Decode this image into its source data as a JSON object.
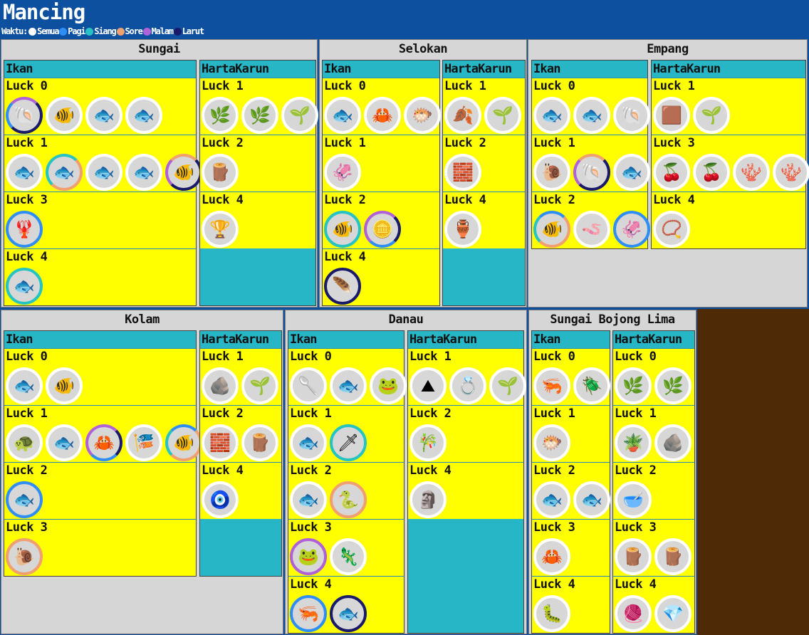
{
  "app": {
    "title": "Mancing",
    "legend_label": "Waktu:",
    "times": [
      {
        "name": "Semua",
        "color": "#ffffff"
      },
      {
        "name": "Pagi",
        "color": "#2f8ef5"
      },
      {
        "name": "Siang",
        "color": "#27c3c3"
      },
      {
        "name": "Sore",
        "color": "#f0a070"
      },
      {
        "name": "Malam",
        "color": "#b060d8"
      },
      {
        "name": "Larut",
        "color": "#1a1a6a"
      }
    ]
  },
  "columns": {
    "fish": "Ikan",
    "treasure": "HartaKarun"
  },
  "locations": {
    "sungai": {
      "name": "Sungai",
      "fish": [
        {
          "luck": "Luck 0",
          "items": [
            {
              "icon": "snail-shell-icon",
              "time": "mix1"
            },
            {
              "icon": "yellow-fish-icon",
              "time": "semua"
            },
            {
              "icon": "carp-icon",
              "time": "semua"
            },
            {
              "icon": "blue-fish-icon",
              "time": "semua"
            }
          ]
        },
        {
          "luck": "Luck 1",
          "items": [
            {
              "icon": "catfish-icon",
              "time": "semua"
            },
            {
              "icon": "silver-fish-icon",
              "time": "mix2"
            },
            {
              "icon": "eel-fish-icon",
              "time": "semua"
            },
            {
              "icon": "mudfish-icon",
              "time": "semua"
            },
            {
              "icon": "tropical-fish-icon",
              "time": "mix3"
            }
          ]
        },
        {
          "luck": "Luck 3",
          "items": [
            {
              "icon": "red-lobster-icon",
              "time": "pagi"
            }
          ]
        },
        {
          "luck": "Luck 4",
          "items": [
            {
              "icon": "pale-fish-icon",
              "time": "siang"
            }
          ]
        }
      ],
      "treasure": [
        {
          "luck": "Luck 1",
          "items": [
            {
              "icon": "herb-sprig-icon",
              "time": "semua"
            },
            {
              "icon": "twig-icon",
              "time": "semua"
            },
            {
              "icon": "moss-clump-icon",
              "time": "semua"
            }
          ]
        },
        {
          "luck": "Luck 2",
          "items": [
            {
              "icon": "log-icon",
              "time": "semua"
            }
          ]
        },
        {
          "luck": "Luck 4",
          "items": [
            {
              "icon": "goblet-icon",
              "time": "semua"
            }
          ]
        }
      ]
    },
    "selokan": {
      "name": "Selokan",
      "fish": [
        {
          "luck": "Luck 0",
          "items": [
            {
              "icon": "pink-fish-icon",
              "time": "semua"
            },
            {
              "icon": "crab-icon",
              "time": "semua"
            },
            {
              "icon": "white-box-fish-icon",
              "time": "semua"
            }
          ]
        },
        {
          "luck": "Luck 1",
          "items": [
            {
              "icon": "grey-squid-icon",
              "time": "semua"
            }
          ]
        },
        {
          "luck": "Luck 2",
          "items": [
            {
              "icon": "red-white-fish-icon",
              "time": "siang"
            },
            {
              "icon": "golden-disc-icon",
              "time": "mix5"
            }
          ]
        },
        {
          "luck": "Luck 4",
          "items": [
            {
              "icon": "feather-icon",
              "time": "larut"
            }
          ]
        }
      ],
      "treasure": [
        {
          "luck": "Luck 1",
          "items": [
            {
              "icon": "dried-leaf-icon",
              "time": "semua"
            },
            {
              "icon": "moss-clump-icon",
              "time": "semua"
            }
          ]
        },
        {
          "luck": "Luck 2",
          "items": [
            {
              "icon": "stone-brick-icon",
              "time": "semua"
            }
          ]
        },
        {
          "luck": "Luck 4",
          "items": [
            {
              "icon": "vase-icon",
              "time": "semua"
            }
          ]
        }
      ]
    },
    "empang": {
      "name": "Empang",
      "fish": [
        {
          "luck": "Luck 0",
          "items": [
            {
              "icon": "catfish-icon",
              "time": "semua"
            },
            {
              "icon": "silver-fish-icon",
              "time": "semua"
            },
            {
              "icon": "clam-icon",
              "time": "semua"
            }
          ]
        },
        {
          "luck": "Luck 1",
          "items": [
            {
              "icon": "snail-icon",
              "time": "semua"
            },
            {
              "icon": "mussel-icon",
              "time": "mix3"
            },
            {
              "icon": "spotted-fish-icon",
              "time": "semua"
            }
          ]
        },
        {
          "luck": "Luck 2",
          "items": [
            {
              "icon": "goldfish-icon",
              "time": "mix4"
            },
            {
              "icon": "worm-icon",
              "time": "semua"
            },
            {
              "icon": "dark-squid-icon",
              "time": "pagi"
            }
          ]
        }
      ],
      "treasure": [
        {
          "luck": "Luck 1",
          "items": [
            {
              "icon": "brown-block-icon",
              "time": "semua"
            },
            {
              "icon": "moss-clump-icon",
              "time": "semua"
            }
          ]
        },
        {
          "luck": "Luck 3",
          "items": [
            {
              "icon": "red-berry-icon",
              "time": "semua"
            },
            {
              "icon": "red-berry-icon",
              "time": "semua"
            },
            {
              "icon": "red-coral-icon",
              "time": "semua"
            },
            {
              "icon": "red-coral-icon",
              "time": "semua"
            }
          ]
        },
        {
          "luck": "Luck 4",
          "items": [
            {
              "icon": "pearl-necklace-icon",
              "time": "semua"
            }
          ]
        }
      ]
    },
    "kolam": {
      "name": "Kolam",
      "fish": [
        {
          "luck": "Luck 0",
          "items": [
            {
              "icon": "grey-fish-icon",
              "time": "semua"
            },
            {
              "icon": "betta-fish-icon",
              "time": "semua"
            }
          ]
        },
        {
          "luck": "Luck 1",
          "items": [
            {
              "icon": "turtle-icon",
              "time": "semua"
            },
            {
              "icon": "long-fish-icon",
              "time": "semua"
            },
            {
              "icon": "orange-crab-icon",
              "time": "mix5"
            },
            {
              "icon": "koi-icon",
              "time": "semua"
            },
            {
              "icon": "rainbow-fish-icon",
              "time": "mix4"
            }
          ]
        },
        {
          "luck": "Luck 2",
          "items": [
            {
              "icon": "red-snapper-icon",
              "time": "pagi"
            }
          ]
        },
        {
          "luck": "Luck 3",
          "items": [
            {
              "icon": "sea-slug-icon",
              "time": "sore"
            }
          ]
        }
      ],
      "treasure": [
        {
          "luck": "Luck 1",
          "items": [
            {
              "icon": "rock-icon",
              "time": "semua"
            },
            {
              "icon": "moss-clump-icon",
              "time": "semua"
            }
          ]
        },
        {
          "luck": "Luck 2",
          "items": [
            {
              "icon": "stone-brick-icon",
              "time": "semua"
            },
            {
              "icon": "log-icon",
              "time": "semua"
            }
          ]
        },
        {
          "luck": "Luck 4",
          "items": [
            {
              "icon": "amulet-icon",
              "time": "semua"
            }
          ]
        }
      ]
    },
    "danau": {
      "name": "Danau",
      "fish": [
        {
          "luck": "Luck 0",
          "items": [
            {
              "icon": "tadpole-icon",
              "time": "semua"
            },
            {
              "icon": "minnow-icon",
              "time": "semua"
            },
            {
              "icon": "frog-icon",
              "time": "semua"
            }
          ]
        },
        {
          "luck": "Luck 1",
          "items": [
            {
              "icon": "bass-icon",
              "time": "semua"
            },
            {
              "icon": "needle-fish-icon",
              "time": "siang"
            }
          ]
        },
        {
          "luck": "Luck 2",
          "items": [
            {
              "icon": "flounder-icon",
              "time": "semua"
            },
            {
              "icon": "lake-eel-icon",
              "time": "sore"
            }
          ]
        },
        {
          "luck": "Luck 3",
          "items": [
            {
              "icon": "toad-icon",
              "time": "malam"
            },
            {
              "icon": "lizard-icon",
              "time": "semua"
            }
          ]
        },
        {
          "luck": "Luck 4",
          "items": [
            {
              "icon": "ghost-shrimp-icon",
              "time": "pagi"
            },
            {
              "icon": "white-fish-icon",
              "time": "larut"
            }
          ]
        }
      ],
      "treasure": [
        {
          "luck": "Luck 1",
          "items": [
            {
              "icon": "sand-pile-icon",
              "time": "semua"
            },
            {
              "icon": "ring-icon",
              "time": "semua"
            },
            {
              "icon": "moss-clump-icon",
              "time": "semua"
            }
          ]
        },
        {
          "luck": "Luck 2",
          "items": [
            {
              "icon": "bamboo-icon",
              "time": "semua"
            }
          ]
        },
        {
          "luck": "Luck 4",
          "items": [
            {
              "icon": "golden-idol-icon",
              "time": "semua"
            }
          ]
        }
      ]
    },
    "bojong": {
      "name": "Sungai Bojong Lima",
      "fish": [
        {
          "luck": "Luck 0",
          "items": [
            {
              "icon": "shrimp-icon",
              "time": "semua"
            },
            {
              "icon": "beetle-icon",
              "time": "semua"
            }
          ]
        },
        {
          "luck": "Luck 1",
          "items": [
            {
              "icon": "puffer-fish-icon",
              "time": "semua"
            }
          ]
        },
        {
          "luck": "Luck 2",
          "items": [
            {
              "icon": "pale-fish-icon",
              "time": "semua"
            },
            {
              "icon": "trout-icon",
              "time": "semua"
            }
          ]
        },
        {
          "luck": "Luck 3",
          "items": [
            {
              "icon": "rock-crab-icon",
              "time": "semua"
            }
          ]
        },
        {
          "luck": "Luck 4",
          "items": [
            {
              "icon": "leech-icon",
              "time": "semua"
            }
          ]
        }
      ],
      "treasure": [
        {
          "luck": "Luck 0",
          "items": [
            {
              "icon": "twig-icon",
              "time": "semua"
            },
            {
              "icon": "herb-sprig-icon",
              "time": "semua"
            }
          ]
        },
        {
          "luck": "Luck 1",
          "items": [
            {
              "icon": "green-plant-icon",
              "time": "semua"
            },
            {
              "icon": "rock-icon",
              "time": "semua"
            }
          ]
        },
        {
          "luck": "Luck 2",
          "items": [
            {
              "icon": "bowl-icon",
              "time": "semua"
            }
          ]
        },
        {
          "luck": "Luck 3",
          "items": [
            {
              "icon": "wood-plank-icon",
              "time": "semua"
            },
            {
              "icon": "wood-bundle-icon",
              "time": "semua"
            }
          ]
        },
        {
          "luck": "Luck 4",
          "items": [
            {
              "icon": "rug-icon",
              "time": "semua"
            },
            {
              "icon": "gem-pile-icon",
              "time": "semua"
            }
          ]
        }
      ]
    }
  }
}
